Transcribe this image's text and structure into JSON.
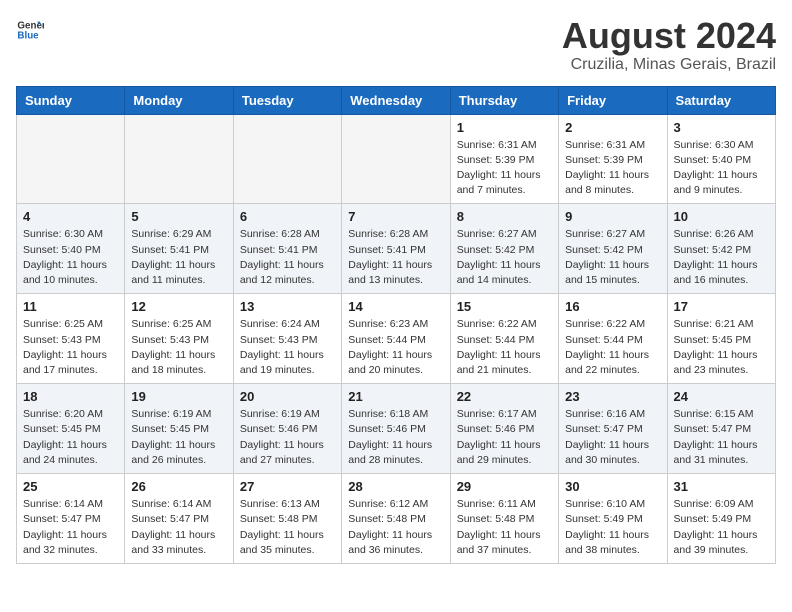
{
  "logo": {
    "text_general": "General",
    "text_blue": "Blue"
  },
  "title": "August 2024",
  "subtitle": "Cruzilia, Minas Gerais, Brazil",
  "weekdays": [
    "Sunday",
    "Monday",
    "Tuesday",
    "Wednesday",
    "Thursday",
    "Friday",
    "Saturday"
  ],
  "weeks": [
    [
      {
        "day": "",
        "info": ""
      },
      {
        "day": "",
        "info": ""
      },
      {
        "day": "",
        "info": ""
      },
      {
        "day": "",
        "info": ""
      },
      {
        "day": "1",
        "info": "Sunrise: 6:31 AM\nSunset: 5:39 PM\nDaylight: 11 hours and 7 minutes."
      },
      {
        "day": "2",
        "info": "Sunrise: 6:31 AM\nSunset: 5:39 PM\nDaylight: 11 hours and 8 minutes."
      },
      {
        "day": "3",
        "info": "Sunrise: 6:30 AM\nSunset: 5:40 PM\nDaylight: 11 hours and 9 minutes."
      }
    ],
    [
      {
        "day": "4",
        "info": "Sunrise: 6:30 AM\nSunset: 5:40 PM\nDaylight: 11 hours and 10 minutes."
      },
      {
        "day": "5",
        "info": "Sunrise: 6:29 AM\nSunset: 5:41 PM\nDaylight: 11 hours and 11 minutes."
      },
      {
        "day": "6",
        "info": "Sunrise: 6:28 AM\nSunset: 5:41 PM\nDaylight: 11 hours and 12 minutes."
      },
      {
        "day": "7",
        "info": "Sunrise: 6:28 AM\nSunset: 5:41 PM\nDaylight: 11 hours and 13 minutes."
      },
      {
        "day": "8",
        "info": "Sunrise: 6:27 AM\nSunset: 5:42 PM\nDaylight: 11 hours and 14 minutes."
      },
      {
        "day": "9",
        "info": "Sunrise: 6:27 AM\nSunset: 5:42 PM\nDaylight: 11 hours and 15 minutes."
      },
      {
        "day": "10",
        "info": "Sunrise: 6:26 AM\nSunset: 5:42 PM\nDaylight: 11 hours and 16 minutes."
      }
    ],
    [
      {
        "day": "11",
        "info": "Sunrise: 6:25 AM\nSunset: 5:43 PM\nDaylight: 11 hours and 17 minutes."
      },
      {
        "day": "12",
        "info": "Sunrise: 6:25 AM\nSunset: 5:43 PM\nDaylight: 11 hours and 18 minutes."
      },
      {
        "day": "13",
        "info": "Sunrise: 6:24 AM\nSunset: 5:43 PM\nDaylight: 11 hours and 19 minutes."
      },
      {
        "day": "14",
        "info": "Sunrise: 6:23 AM\nSunset: 5:44 PM\nDaylight: 11 hours and 20 minutes."
      },
      {
        "day": "15",
        "info": "Sunrise: 6:22 AM\nSunset: 5:44 PM\nDaylight: 11 hours and 21 minutes."
      },
      {
        "day": "16",
        "info": "Sunrise: 6:22 AM\nSunset: 5:44 PM\nDaylight: 11 hours and 22 minutes."
      },
      {
        "day": "17",
        "info": "Sunrise: 6:21 AM\nSunset: 5:45 PM\nDaylight: 11 hours and 23 minutes."
      }
    ],
    [
      {
        "day": "18",
        "info": "Sunrise: 6:20 AM\nSunset: 5:45 PM\nDaylight: 11 hours and 24 minutes."
      },
      {
        "day": "19",
        "info": "Sunrise: 6:19 AM\nSunset: 5:45 PM\nDaylight: 11 hours and 26 minutes."
      },
      {
        "day": "20",
        "info": "Sunrise: 6:19 AM\nSunset: 5:46 PM\nDaylight: 11 hours and 27 minutes."
      },
      {
        "day": "21",
        "info": "Sunrise: 6:18 AM\nSunset: 5:46 PM\nDaylight: 11 hours and 28 minutes."
      },
      {
        "day": "22",
        "info": "Sunrise: 6:17 AM\nSunset: 5:46 PM\nDaylight: 11 hours and 29 minutes."
      },
      {
        "day": "23",
        "info": "Sunrise: 6:16 AM\nSunset: 5:47 PM\nDaylight: 11 hours and 30 minutes."
      },
      {
        "day": "24",
        "info": "Sunrise: 6:15 AM\nSunset: 5:47 PM\nDaylight: 11 hours and 31 minutes."
      }
    ],
    [
      {
        "day": "25",
        "info": "Sunrise: 6:14 AM\nSunset: 5:47 PM\nDaylight: 11 hours and 32 minutes."
      },
      {
        "day": "26",
        "info": "Sunrise: 6:14 AM\nSunset: 5:47 PM\nDaylight: 11 hours and 33 minutes."
      },
      {
        "day": "27",
        "info": "Sunrise: 6:13 AM\nSunset: 5:48 PM\nDaylight: 11 hours and 35 minutes."
      },
      {
        "day": "28",
        "info": "Sunrise: 6:12 AM\nSunset: 5:48 PM\nDaylight: 11 hours and 36 minutes."
      },
      {
        "day": "29",
        "info": "Sunrise: 6:11 AM\nSunset: 5:48 PM\nDaylight: 11 hours and 37 minutes."
      },
      {
        "day": "30",
        "info": "Sunrise: 6:10 AM\nSunset: 5:49 PM\nDaylight: 11 hours and 38 minutes."
      },
      {
        "day": "31",
        "info": "Sunrise: 6:09 AM\nSunset: 5:49 PM\nDaylight: 11 hours and 39 minutes."
      }
    ]
  ]
}
